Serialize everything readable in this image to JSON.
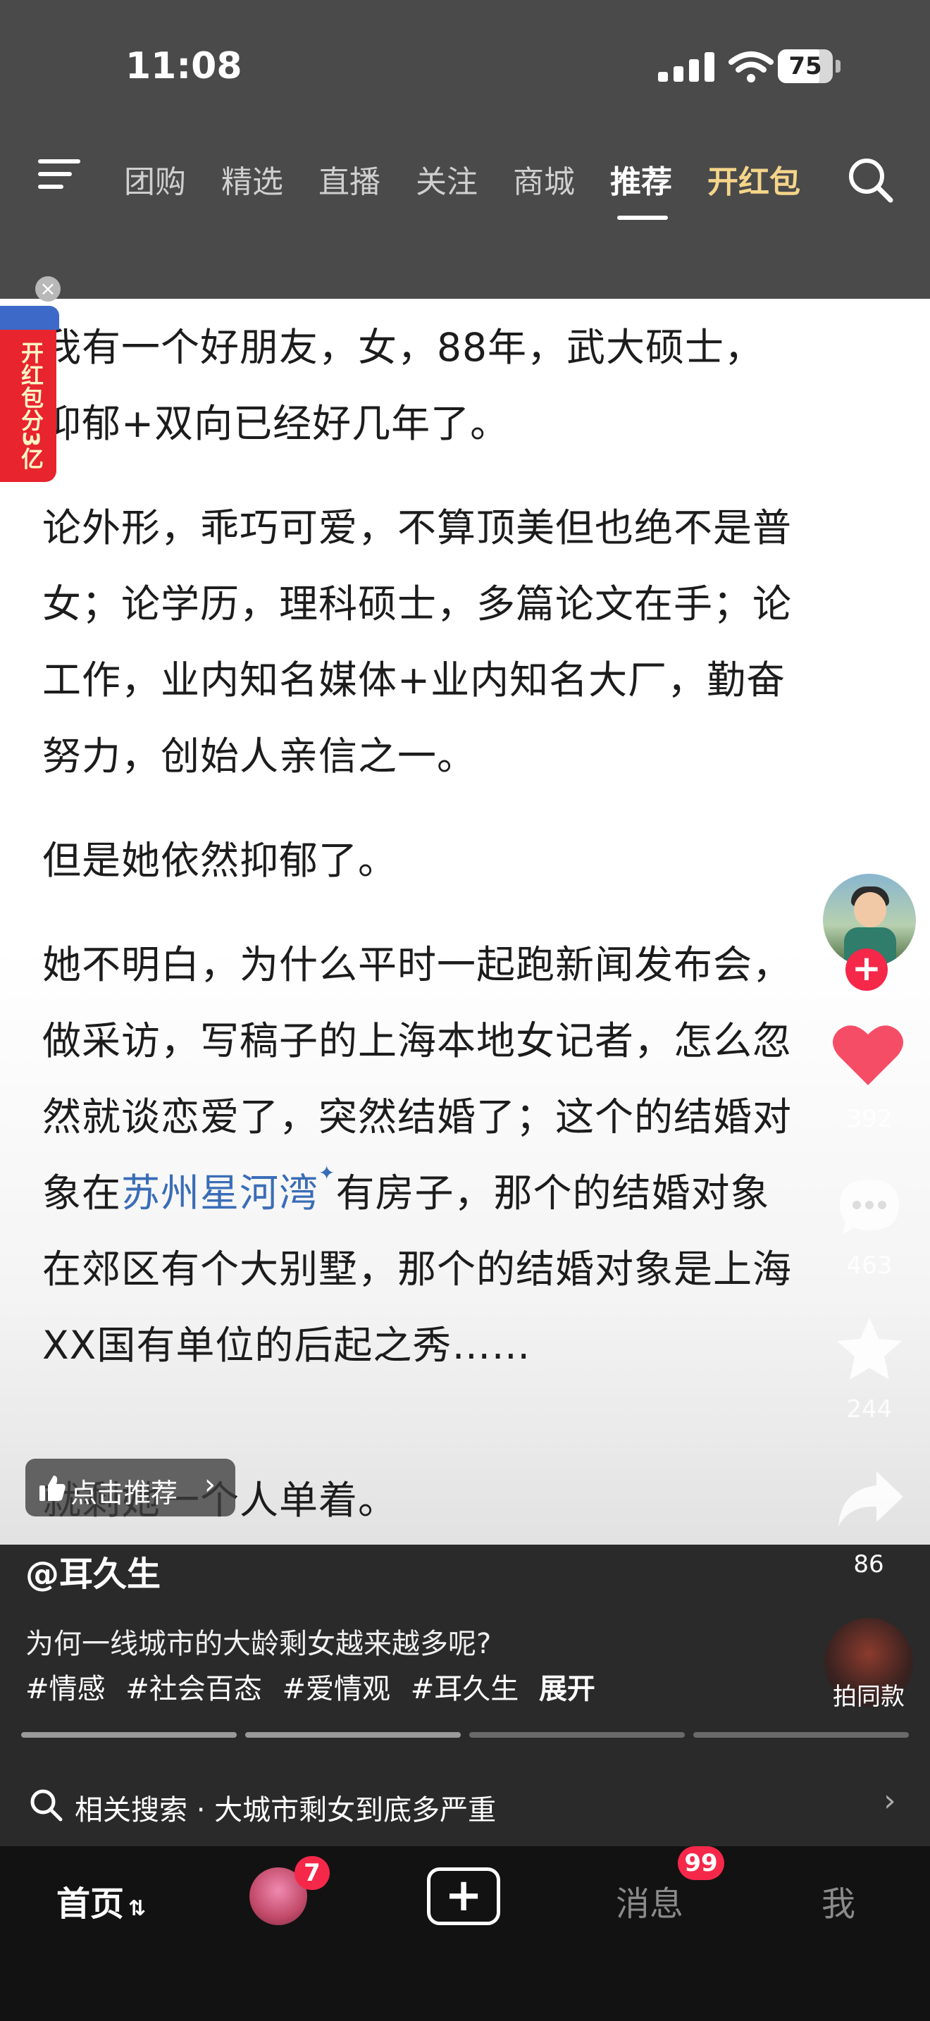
{
  "status_bar": {
    "time": "11:08",
    "battery": "75"
  },
  "nav": {
    "tabs": [
      {
        "label": "团购"
      },
      {
        "label": "精选"
      },
      {
        "label": "直播"
      },
      {
        "label": "关注"
      },
      {
        "label": "商城"
      },
      {
        "label": "推荐",
        "active": true
      },
      {
        "label": "开红包",
        "highlight": true
      }
    ],
    "menu_icon": "menu-icon",
    "search_icon": "search-icon"
  },
  "red_packet": {
    "text": "开红包分3亿",
    "close": "×"
  },
  "article": {
    "lines": [
      "我有一个好朋友，女，88年，武大硕士，",
      "抑郁+双向已经好几年了。",
      "论外形，乖巧可爱，不算顶美但也绝不是普",
      "女；论学历，理科硕士，多篇论文在手；论",
      "工作，业内知名媒体+业内知名大厂，勤奋",
      "努力，创始人亲信之一。",
      "但是她依然抑郁了。",
      "她不明白，为什么平时一起跑新闻发布会，",
      "做采访，写稿子的上海本地女记者，怎么忽",
      "然就谈恋爱了，突然结婚了；这个的结婚对",
      "象在",
      "苏州星河湾",
      "有房子，那个的结婚对象",
      "在郊区有个大别墅，那个的结婚对象是上海",
      "XX国有单位的后起之秀……",
      "就剩她一个人单着。"
    ],
    "link_spark": "✦"
  },
  "side_actions": {
    "likes": "392",
    "comments": "463",
    "favorites": "244",
    "shares": "86",
    "follow": "+"
  },
  "recommend_pill": {
    "label": "点击推荐",
    "chevron": "›"
  },
  "post": {
    "author": "@耳久生",
    "description": "为何一线城市的大龄剩女越来越多呢?",
    "tags": [
      "#情感",
      "#社会百态",
      "#爱情观",
      "#耳久生"
    ],
    "expand": "展开",
    "same_style": "拍同款"
  },
  "related_search": {
    "prefix": "相关搜索",
    "separator": "·",
    "query": "大城市剩女到底多严重",
    "arrow": "›"
  },
  "tabbar": {
    "home": "首页",
    "home_arrows": "⇅",
    "friends_badge": "7",
    "add": "+",
    "messages": "消息",
    "messages_badge": "99",
    "me": "我"
  },
  "colors": {
    "accent_red": "#f5284a",
    "gold": "#f4d58a",
    "link_blue": "#3a6db7"
  }
}
